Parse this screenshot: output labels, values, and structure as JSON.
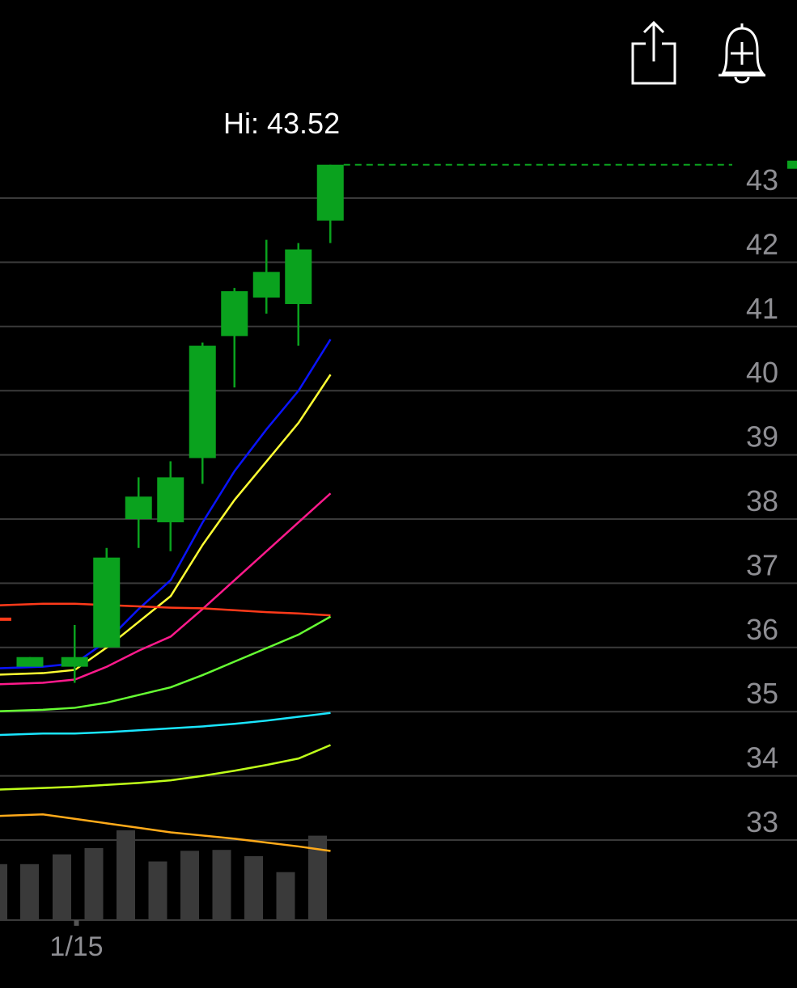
{
  "toolbar": {
    "share_icon": "share-icon",
    "alert_icon": "add-alert-bell-icon"
  },
  "hi_label": "Hi: 43.52",
  "chart_data": {
    "type": "candlestick",
    "ylim": [
      32.5,
      43.6
    ],
    "yticks": [
      "43",
      "42",
      "41",
      "40",
      "39",
      "38",
      "37",
      "36",
      "35",
      "34",
      "33"
    ],
    "xticks": [
      {
        "label": "1/15",
        "candle_index": 1
      }
    ],
    "grid": true,
    "colors": {
      "up": "#0aa21e",
      "volume": "#3a3a3a",
      "axis_text": "#8e8e93",
      "grid": "#3a3a3a"
    },
    "high_marker": 43.52,
    "candles": [
      {
        "open": 35.7,
        "high": 35.85,
        "low": 35.8,
        "close": 35.85
      },
      {
        "open": 35.7,
        "high": 36.35,
        "low": 35.45,
        "close": 35.85
      },
      {
        "open": 36.0,
        "high": 37.55,
        "low": 36.0,
        "close": 37.4
      },
      {
        "open": 38.0,
        "high": 38.65,
        "low": 37.55,
        "close": 38.35
      },
      {
        "open": 37.95,
        "high": 38.9,
        "low": 37.5,
        "close": 38.65
      },
      {
        "open": 38.95,
        "high": 40.75,
        "low": 38.55,
        "close": 40.7
      },
      {
        "open": 40.85,
        "high": 41.6,
        "low": 40.05,
        "close": 41.55
      },
      {
        "open": 41.45,
        "high": 42.35,
        "low": 41.2,
        "close": 41.85
      },
      {
        "open": 41.35,
        "high": 42.3,
        "low": 40.7,
        "close": 42.2
      },
      {
        "open": 42.65,
        "high": 43.52,
        "low": 42.3,
        "close": 43.52
      }
    ],
    "volume": [
      0.62,
      0.73,
      0.8,
      1.0,
      0.65,
      0.77,
      0.78,
      0.71,
      0.53,
      0.94
    ],
    "series": [
      {
        "color": "#0a14ff",
        "values": [
          35.7,
          35.75,
          36.1,
          36.6,
          37.05,
          37.95,
          38.75,
          39.4,
          40.0,
          40.8
        ]
      },
      {
        "color": "#ffff33",
        "values": [
          35.6,
          35.65,
          36.0,
          36.4,
          36.8,
          37.6,
          38.3,
          38.9,
          39.5,
          40.25
        ]
      },
      {
        "color": "#ff1a8c",
        "values": [
          35.45,
          35.5,
          35.7,
          35.95,
          36.17,
          36.6,
          37.05,
          37.5,
          37.95,
          38.4
        ]
      },
      {
        "color": "#ff3a1a",
        "values": [
          36.68,
          36.68,
          36.66,
          36.64,
          36.62,
          36.61,
          36.58,
          36.55,
          36.53,
          36.5
        ]
      },
      {
        "color": "#66ff33",
        "values": [
          35.03,
          35.06,
          35.14,
          35.26,
          35.38,
          35.57,
          35.78,
          35.99,
          36.2,
          36.48
        ]
      },
      {
        "color": "#1ae6ff",
        "values": [
          34.66,
          34.66,
          34.68,
          34.71,
          34.74,
          34.77,
          34.81,
          34.86,
          34.92,
          34.98
        ]
      },
      {
        "color": "#bfff1a",
        "values": [
          33.81,
          33.83,
          33.86,
          33.89,
          33.93,
          34.0,
          34.08,
          34.17,
          34.27,
          34.48
        ]
      },
      {
        "color": "#ffaa1a",
        "values": [
          33.4,
          33.33,
          33.26,
          33.19,
          33.12,
          33.07,
          33.02,
          32.96,
          32.9,
          32.83
        ]
      }
    ]
  }
}
